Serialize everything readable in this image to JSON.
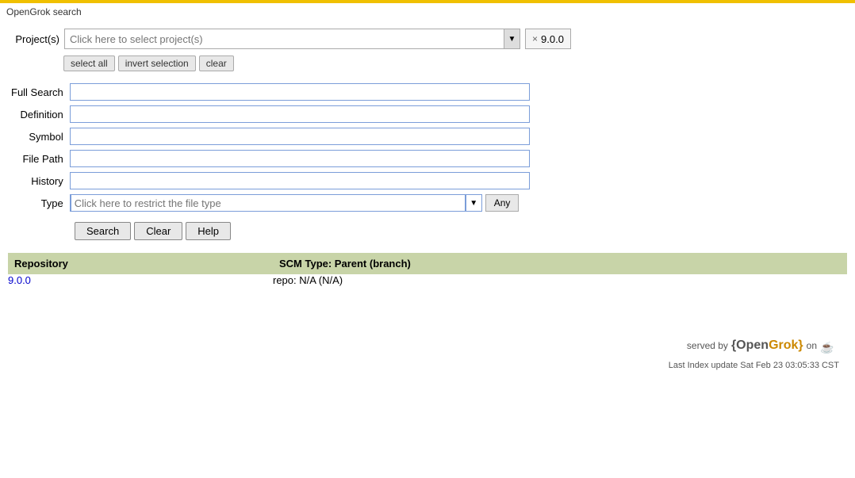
{
  "title": "OpenGrok search",
  "topbar": {
    "color": "#f0c000"
  },
  "projects": {
    "label": "Project(s)",
    "placeholder": "Click here to select project(s)",
    "version": "9.0.0",
    "version_prefix": "× 9.0.0"
  },
  "selection_buttons": {
    "select_all": "select all",
    "invert_selection": "invert selection",
    "clear": "clear"
  },
  "search_form": {
    "full_search_label": "Full Search",
    "definition_label": "Definition",
    "symbol_label": "Symbol",
    "file_path_label": "File Path",
    "history_label": "History",
    "type_label": "Type",
    "type_placeholder": "Click here to restrict the file type",
    "any_label": "Any"
  },
  "action_buttons": {
    "search": "Search",
    "clear": "Clear",
    "help": "Help"
  },
  "repository_table": {
    "col1_header": "Repository",
    "col2_header": "SCM Type: Parent (branch)",
    "rows": [
      {
        "repo": "9.0.0",
        "scm": "repo: N/A (N/A)"
      }
    ]
  },
  "footer": {
    "served_by": "served by",
    "brand": "{OpenGrok}",
    "brand_open": "{Open",
    "brand_grok": "Grok}",
    "on_text": "on",
    "last_index": "Last Index update Sat Feb 23 03:05:33 CST"
  }
}
